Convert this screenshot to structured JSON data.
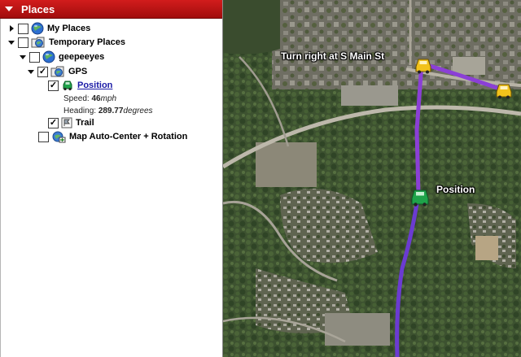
{
  "panel": {
    "title": "Places",
    "items": [
      {
        "label": "My Places"
      },
      {
        "label": "Temporary Places"
      },
      {
        "label": "geepeeyes"
      },
      {
        "label": "GPS"
      },
      {
        "label": "Position"
      },
      {
        "label": "Trail"
      },
      {
        "label": "Map Auto-Center + Rotation"
      }
    ],
    "position_details": {
      "speed_label": "Speed:",
      "speed_value": "46",
      "speed_unit": "mph",
      "heading_label": "Heading:",
      "heading_value": "289.77",
      "heading_unit": "degrees"
    }
  },
  "map": {
    "turn_label": "Turn right at S Main St",
    "position_label": "Position",
    "route_color": "#8b3fd6",
    "vehicle_color": "#1fa34a",
    "waypoint_color": "#f2c21b"
  }
}
